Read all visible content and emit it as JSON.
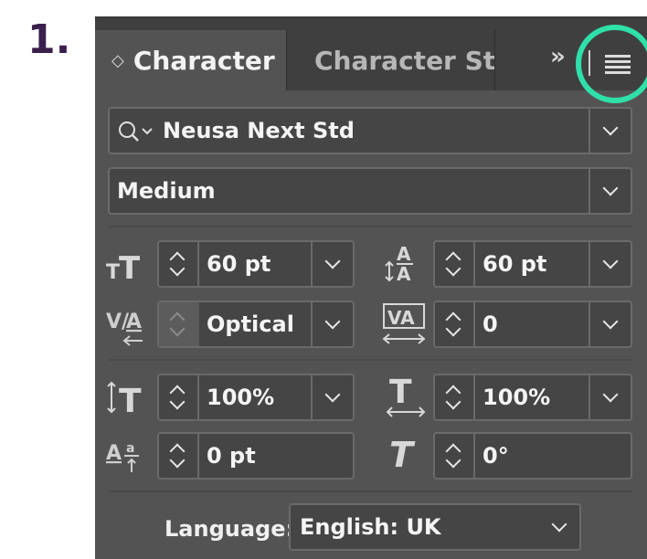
{
  "step_label": "1.",
  "tabs": {
    "active_label": "Character",
    "active_arrows": "◇",
    "inactive_label": "Character Styl",
    "overflow": "»"
  },
  "font": {
    "family": "Neusa Next Std",
    "style": "Medium"
  },
  "metrics": {
    "size": "60 pt",
    "leading": "60 pt",
    "kerning": "Optical",
    "tracking": "0",
    "vertical_scale": "100%",
    "horizontal_scale": "100%",
    "baseline_shift": "0 pt",
    "skew": "0°"
  },
  "language": {
    "label": "Language:",
    "value": "English: UK"
  },
  "colors": {
    "panel_bg": "#535353",
    "highlight": "#2fe0a9",
    "step_color": "#3a1f4d"
  }
}
